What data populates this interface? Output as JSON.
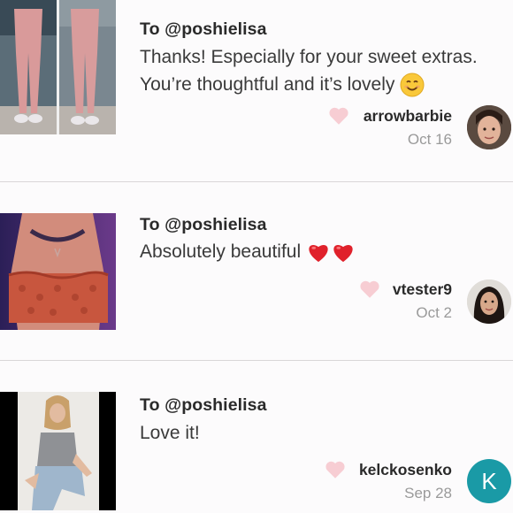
{
  "notes": [
    {
      "to": "To @poshielisa",
      "message_line1": "Thanks! Especially for your sweet extras.",
      "message_line2": "You’re thoughtful and it’s lovely",
      "emoji": "smiling-face",
      "username": "arrowbarbie",
      "date": "Oct 16"
    },
    {
      "to": "To @poshielisa",
      "message_line1": "Absolutely beautiful",
      "emoji": "two-red-hearts",
      "username": "vtester9",
      "date": "Oct 2"
    },
    {
      "to": "To @poshielisa",
      "message_line1": "Love it!",
      "username": "kelckosenko",
      "date": "Sep 28",
      "avatar_letter": "K"
    }
  ],
  "colors": {
    "heart": "#f7cdd3",
    "avatar_teal": "#1a9aa6",
    "divider": "#d9d6d8"
  }
}
